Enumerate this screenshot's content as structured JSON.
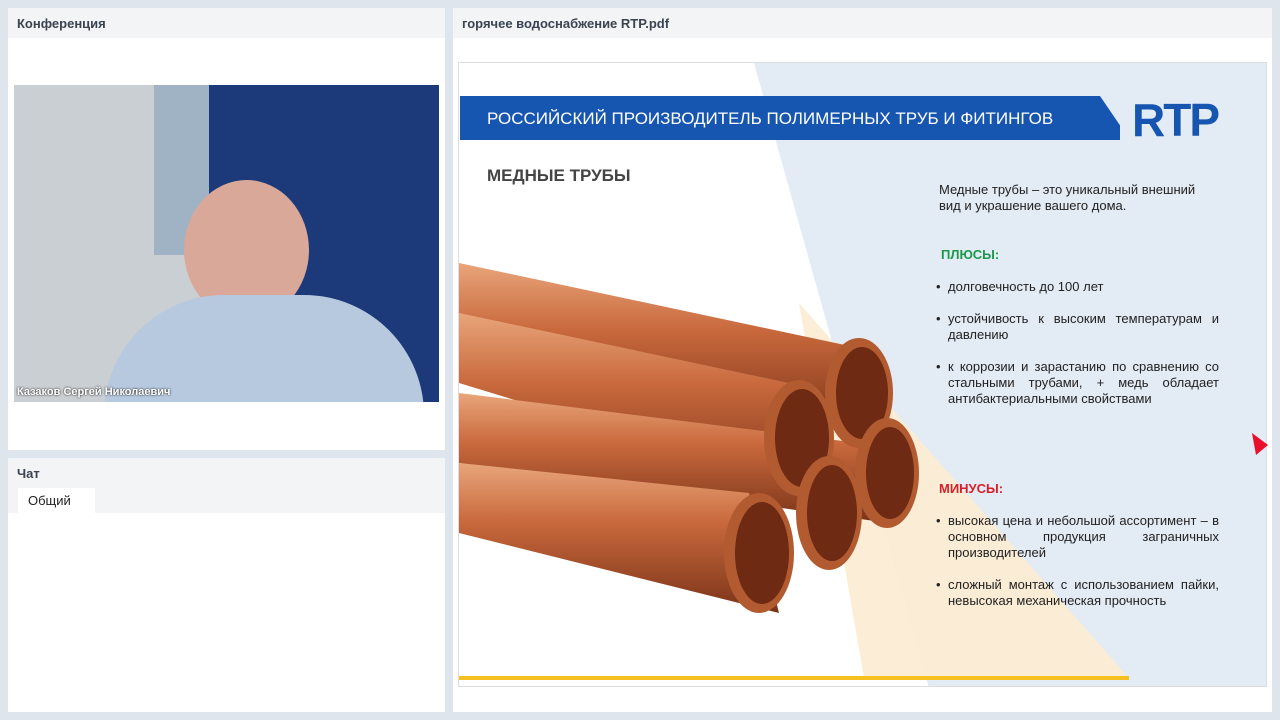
{
  "conference": {
    "title": "Конференция",
    "participant": "Казаков Сергей Николаевич"
  },
  "chat": {
    "title": "Чат",
    "tab": "Общий"
  },
  "document": {
    "title": "горячее водоснабжение RTP.pdf",
    "slide": {
      "banner": "РОССИЙСКИЙ ПРОИЗВОДИТЕЛЬ ПОЛИМЕРНЫХ ТРУБ И ФИТИНГОВ",
      "logo": "RTP",
      "heading": "МЕДНЫЕ ТРУБЫ",
      "intro": "Медные трубы – это уникальный внешний вид и украшение вашего дома.",
      "pros_title": "ПЛЮСЫ:",
      "pros": [
        "долговечность до 100 лет",
        "устойчивость к высоким температурам и давлению",
        "к коррозии и зарастанию по сравнению со стальными трубами, + медь обладает антибактериальными свойствами"
      ],
      "cons_title": "МИНУСЫ:",
      "cons": [
        "высокая цена и небольшой ассортимент – в основном продукция заграничных производителей",
        "сложный монтаж с использованием пайки, невысокая механическая прочность"
      ]
    }
  },
  "colors": {
    "brand": "#1656b0",
    "plus": "#1a9a4a",
    "minus": "#d8202a",
    "accent": "#f6c020"
  }
}
